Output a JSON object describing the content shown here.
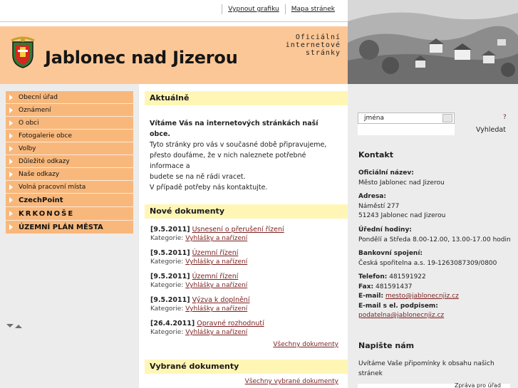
{
  "toplinks": {
    "graphics_off": "Vypnout grafiku",
    "sitemap": "Mapa stránek"
  },
  "header": {
    "title": "Jablonec nad Jizerou",
    "tagline_1": "Oficiální",
    "tagline_2": "internetové",
    "tagline_3": "stránky"
  },
  "menu": {
    "items": [
      {
        "label": "Obecní úřad"
      },
      {
        "label": "Oznámení"
      },
      {
        "label": "O obci"
      },
      {
        "label": "Fotogalerie obce"
      },
      {
        "label": "Volby"
      },
      {
        "label": "Důležité odkazy"
      },
      {
        "label": "Naše odkazy"
      },
      {
        "label": "Volná pracovní místa"
      },
      {
        "label": "CzechPoint"
      },
      {
        "label": "KRKONOŠE"
      },
      {
        "label": "ÚZEMNÍ PLÁN MĚSTA"
      }
    ]
  },
  "news": {
    "heading": "Aktuálně",
    "welcome": "Vítáme Vás na internetových stránkách naší obce.",
    "line1": "Tyto stránky pro vás v současné době připravujeme,",
    "line2": "přesto doufáme, že v nich naleznete potřebné informace a",
    "line3": "budete se na ně rádi vracet.",
    "line4": "V případě potřeby nás kontaktujte."
  },
  "docs": {
    "heading": "Nové dokumenty",
    "category_label": "Kategorie:",
    "items": [
      {
        "date": "[9.5.2011]",
        "title": "Usnesení o přerušení řízení",
        "category": "Vyhlášky a nařízení"
      },
      {
        "date": "[9.5.2011]",
        "title": "Územní řízení",
        "category": "Vyhlášky a nařízení"
      },
      {
        "date": "[9.5.2011]",
        "title": "Územní řízení",
        "category": "Vyhlášky a nařízení"
      },
      {
        "date": "[9.5.2011]",
        "title": "Výzva k doplnění",
        "category": "Vyhlášky a nařízení"
      },
      {
        "date": "[26.4.2011]",
        "title": "Opravné rozhodnutí",
        "category": "Vyhlášky a nařízení"
      }
    ],
    "all_link": "Všechny dokumenty"
  },
  "selected": {
    "heading": "Vybrané dokumenty",
    "all_link": "Všechny vybrané dokumenty"
  },
  "search": {
    "value": "jména",
    "help": "?",
    "button": "Vyhledat"
  },
  "contact": {
    "heading": "Kontakt",
    "official_name_label": "Oficiální název:",
    "official_name": "Město Jablonec nad Jizerou",
    "address_label": "Adresa:",
    "address_1": "Náměstí 277",
    "address_2": "51243 Jablonec nad Jizerou",
    "hours_label": "Úřední hodiny:",
    "hours": "Pondělí a Středa 8.00-12.00, 13.00-17.00 hodin",
    "bank_label": "Bankovní spojení:",
    "bank": "Česká spořitelna a.s. 19-1263087309/0800",
    "phone_label": "Telefon:",
    "phone": "481591922",
    "fax_label": "Fax:",
    "fax": "481591437",
    "email_label": "E-mail:",
    "email": "mesto@jablonecnjiz.cz",
    "esign_label": "E-mail s el. podpisem:",
    "esign": "podatelna@jablonecnjiz.cz"
  },
  "write": {
    "heading": "Napište nám",
    "text1": "Uvítáme Vaše připomínky k obsahu našich",
    "text2": "stránek",
    "bottom_label": "Zpráva pro úřad"
  },
  "colors": {
    "header_bg": "#fcc796",
    "menu_bg": "#f8b87c",
    "section_bg": "#fff6b6",
    "link": "#7a1e1e"
  }
}
